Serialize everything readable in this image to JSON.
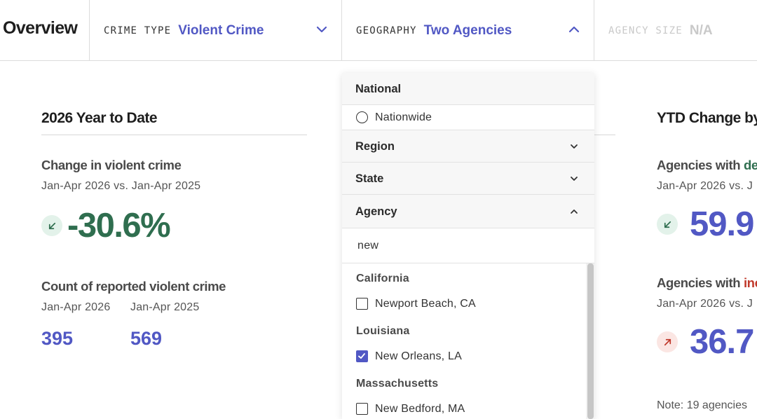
{
  "header": {
    "title": "Overview",
    "filters": [
      {
        "key": "CRIME TYPE",
        "value": "Violent Crime",
        "state": "collapsed"
      },
      {
        "key": "GEOGRAPHY",
        "value": "Two Agencies",
        "state": "expanded"
      },
      {
        "key": "AGENCY SIZE",
        "value": "N/A",
        "state": "disabled"
      }
    ]
  },
  "left": {
    "section_title": "2026 Year to Date",
    "change": {
      "title": "Change in violent crime",
      "subtitle": "Jan-Apr 2026 vs. Jan-Apr 2025",
      "value": "-30.6%",
      "icon": "arrow-down-left-icon"
    },
    "count": {
      "title": "Count of reported violent crime",
      "label_2026": "Jan-Apr 2026",
      "label_2025": "Jan-Apr 2025",
      "value_2026": "395",
      "value_2025": "569"
    }
  },
  "right": {
    "section_title": "YTD Change by",
    "decreases": {
      "title_prefix": "Agencies with ",
      "title_highlight": "de",
      "subtitle": "Jan-Apr 2026 vs. J",
      "value": "59.9",
      "icon": "arrow-down-left-icon"
    },
    "increases": {
      "title_prefix": "Agencies with ",
      "title_highlight": "inc",
      "subtitle": "Jan-Apr 2026 vs. J",
      "value": "36.7",
      "icon": "arrow-up-right-icon"
    },
    "note": "Note: 19 agencies"
  },
  "dropdown": {
    "national_header": "National",
    "nationwide_option": "Nationwide",
    "region_header": "Region",
    "state_header": "State",
    "agency_header": "Agency",
    "search_value": "new",
    "groups": [
      {
        "name": "California",
        "options": [
          {
            "label": "Newport Beach, CA",
            "checked": false
          }
        ]
      },
      {
        "name": "Louisiana",
        "options": [
          {
            "label": "New Orleans, LA",
            "checked": true
          }
        ]
      },
      {
        "name": "Massachusetts",
        "options": [
          {
            "label": "New Bedford, MA",
            "checked": false
          }
        ]
      }
    ]
  },
  "colors": {
    "accent_blue": "#5158c4",
    "positive_green": "#2f6e4f",
    "negative_red": "#c0392b"
  }
}
